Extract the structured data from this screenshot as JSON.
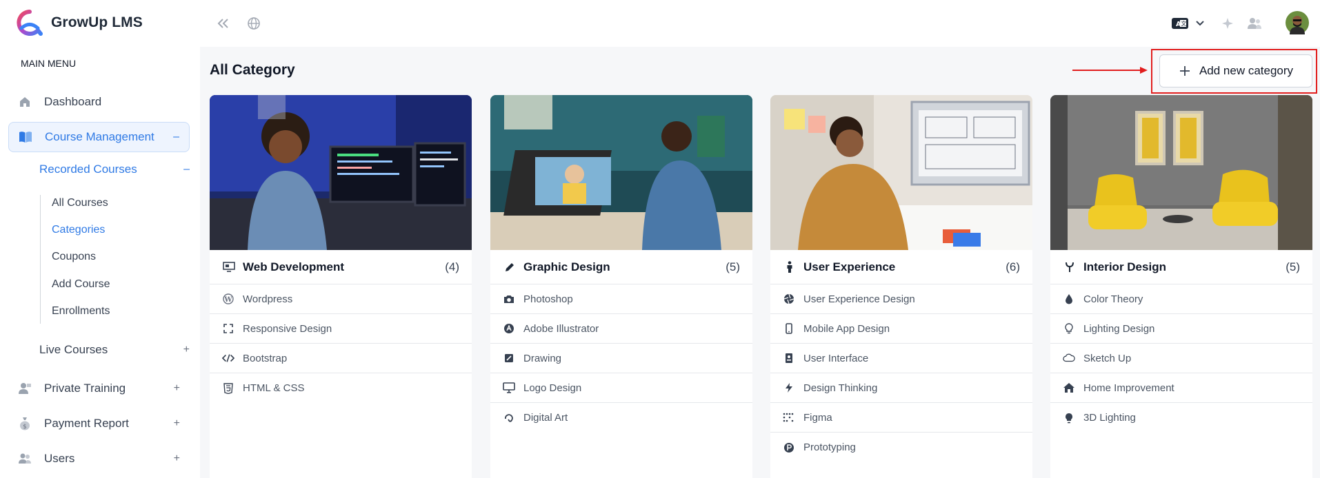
{
  "app": {
    "name": "GrowUp LMS"
  },
  "sidebar": {
    "section_label": "MAIN MENU",
    "items": [
      {
        "label": "Dashboard",
        "icon": "home-icon"
      },
      {
        "label": "Course Management",
        "icon": "book-icon",
        "toggle": "–"
      },
      {
        "label": "Private Training",
        "icon": "trainer-icon",
        "toggle": "+"
      },
      {
        "label": "Payment Report",
        "icon": "money-bag-icon",
        "toggle": "+"
      },
      {
        "label": "Users",
        "icon": "users-icon",
        "toggle": "+"
      }
    ],
    "sub_items": [
      {
        "label": "Recorded Courses",
        "toggle": "–"
      },
      {
        "label": "Live Courses",
        "toggle": "+"
      }
    ],
    "leaves": [
      "All Courses",
      "Categories",
      "Coupons",
      "Add Course",
      "Enrollments"
    ]
  },
  "topbar": {
    "icons": [
      "collapse-sidebar-icon",
      "globe-icon",
      "language-icon",
      "chevron-down-icon",
      "sparkle-icon",
      "user-switch-icon",
      "avatar"
    ]
  },
  "main": {
    "title": "All Category",
    "add_button_label": "Add new category"
  },
  "categories": [
    {
      "title": "Web Development",
      "count": "(4)",
      "icon": "web-layout-icon",
      "image": "woman-at-computer-photo",
      "items": [
        {
          "label": "Wordpress",
          "icon": "wordpress-icon"
        },
        {
          "label": "Responsive Design",
          "icon": "expand-icon"
        },
        {
          "label": "Bootstrap",
          "icon": "code-icon"
        },
        {
          "label": "HTML & CSS",
          "icon": "html5-icon"
        }
      ]
    },
    {
      "title": "Graphic Design",
      "count": "(5)",
      "icon": "pen-icon",
      "image": "designer-at-tablet-photo",
      "items": [
        {
          "label": "Photoshop",
          "icon": "camera-icon"
        },
        {
          "label": "Adobe Illustrator",
          "icon": "illustrator-icon"
        },
        {
          "label": "Drawing",
          "icon": "drawing-icon"
        },
        {
          "label": "Logo Design",
          "icon": "monitor-icon"
        },
        {
          "label": "Digital Art",
          "icon": "swirl-icon"
        }
      ]
    },
    {
      "title": "User Experience",
      "count": "(6)",
      "icon": "person-icon",
      "image": "man-sketching-wireframes-photo",
      "items": [
        {
          "label": "User Experience Design",
          "icon": "aperture-icon"
        },
        {
          "label": "Mobile App Design",
          "icon": "mobile-icon"
        },
        {
          "label": "User Interface",
          "icon": "id-card-icon"
        },
        {
          "label": "Design Thinking",
          "icon": "bolt-icon"
        },
        {
          "label": "Figma",
          "icon": "figma-icon"
        },
        {
          "label": "Prototyping",
          "icon": "product-hunt-icon"
        }
      ]
    },
    {
      "title": "Interior Design",
      "count": "(5)",
      "icon": "y-fork-icon",
      "image": "yellow-armchairs-room-photo",
      "items": [
        {
          "label": "Color Theory",
          "icon": "droplet-icon"
        },
        {
          "label": "Lighting Design",
          "icon": "lightbulb-outline-icon"
        },
        {
          "label": "Sketch Up",
          "icon": "cloud-icon"
        },
        {
          "label": "Home Improvement",
          "icon": "house-icon"
        },
        {
          "label": "3D Lighting",
          "icon": "lightbulb-solid-icon"
        }
      ]
    }
  ],
  "colors": {
    "accent": "#2f7ae5",
    "annotation": "#e11d1d",
    "background": "#f6f7f9"
  }
}
